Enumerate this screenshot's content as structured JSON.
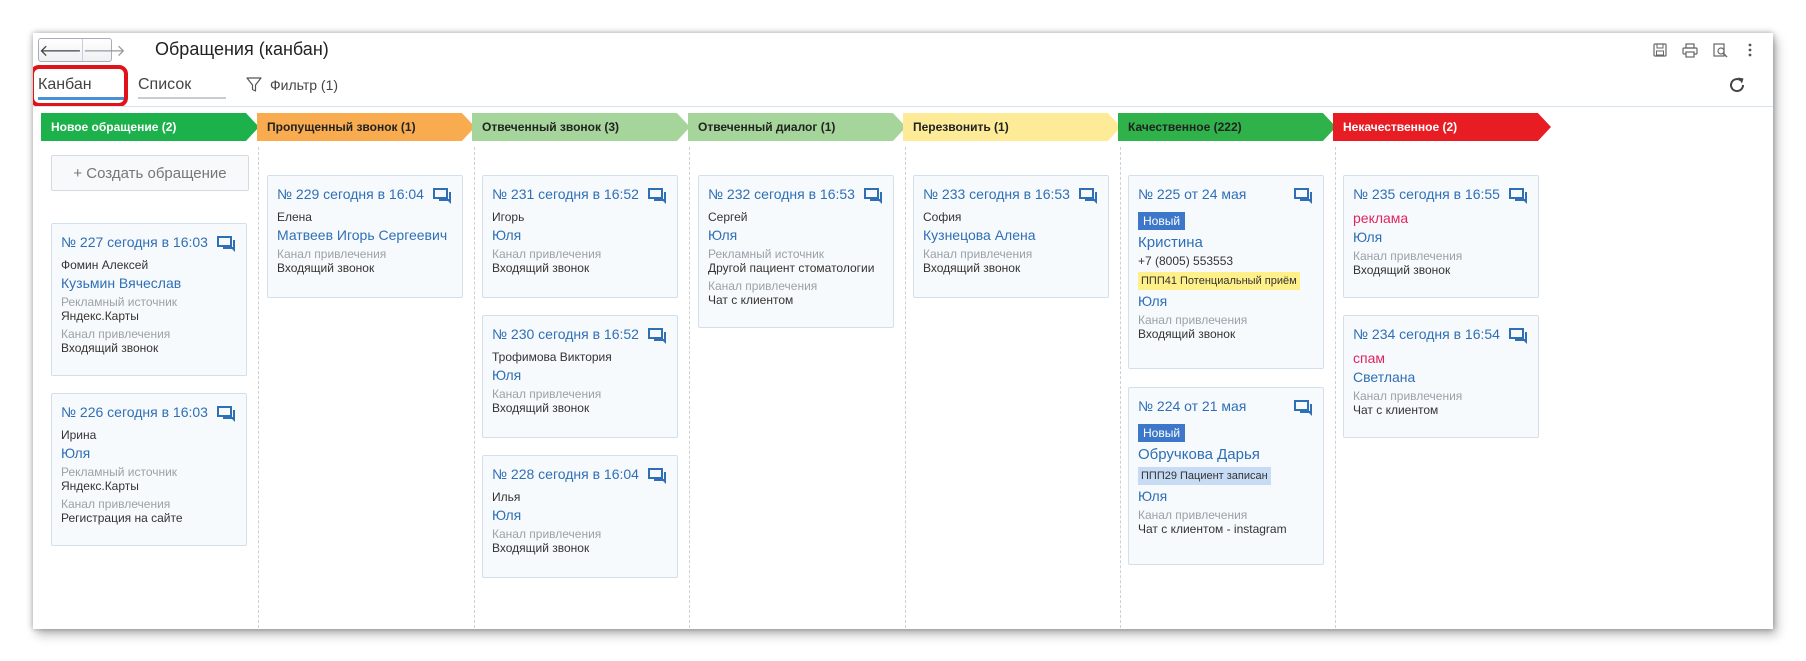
{
  "window": {
    "title": "Обращения (канбан)"
  },
  "nav": {
    "back": "🡐",
    "forward": "🡒"
  },
  "top_icons": [
    "save-icon",
    "print-icon",
    "preview-icon",
    "more-icon"
  ],
  "tabs": [
    {
      "label": "Канбан",
      "active": true
    },
    {
      "label": "Список",
      "active": false
    }
  ],
  "filter": {
    "label": "Фильтр (1)"
  },
  "columns": [
    {
      "title": "Новое обращение (2)",
      "color": "#1db14b",
      "create_label": "+ Создать обращение",
      "cards": [
        {
          "title": "№ 227 сегодня в 16:03",
          "client": "Фомин Алексей",
          "manager": "Кузьмин Вячеслав",
          "src_label": "Рекламный источник",
          "src_value": "Яндекс.Карты",
          "ch_label": "Канал привлечения",
          "ch_value": "Входящий звонок"
        },
        {
          "title": "№ 226 сегодня в 16:03",
          "client": "Ирина",
          "manager": "Юля",
          "src_label": "Рекламный источник",
          "src_value": "Яндекс.Карты",
          "ch_label": "Канал привлечения",
          "ch_value": "Регистрация на сайте"
        }
      ]
    },
    {
      "title": "Пропущенный звонок (1)",
      "color": "#f9ab4f",
      "cards": [
        {
          "title": "№ 229 сегодня в 16:04",
          "client": "Елена",
          "manager": "Матвеев Игорь Сергеевич",
          "ch_label": "Канал привлечения",
          "ch_value": "Входящий звонок"
        }
      ]
    },
    {
      "title": "Отвеченный звонок (3)",
      "color": "#a5d59a",
      "cards": [
        {
          "title": "№ 231 сегодня в 16:52",
          "client": "Игорь",
          "manager": "Юля",
          "ch_label": "Канал привлечения",
          "ch_value": "Входящий звонок"
        },
        {
          "title": "№ 230 сегодня в 16:52",
          "client": "Трофимова Виктория",
          "manager": "Юля",
          "ch_label": "Канал привлечения",
          "ch_value": "Входящий звонок"
        },
        {
          "title": "№ 228 сегодня в 16:04",
          "client": "Илья",
          "manager": "Юля",
          "ch_label": "Канал привлечения",
          "ch_value": "Входящий звонок"
        }
      ]
    },
    {
      "title": "Отвеченный диалог (1)",
      "color": "#a5d59a",
      "cards": [
        {
          "title": "№ 232 сегодня в 16:53",
          "client": "Сергей",
          "manager": "Юля",
          "src_label": "Рекламный источник",
          "src_value": "Другой пациент стоматологии",
          "ch_label": "Канал привлечения",
          "ch_value": "Чат с клиентом"
        }
      ]
    },
    {
      "title": "Перезвонить (1)",
      "color": "#fdeb98",
      "cards": [
        {
          "title": "№ 233 сегодня в 16:53",
          "client": "София",
          "manager": "Кузнецова Алена",
          "ch_label": "Канал привлечения",
          "ch_value": "Входящий звонок"
        }
      ]
    },
    {
      "title": "Качественное (222)",
      "color": "#2fb24a",
      "cards": [
        {
          "title": "№ 225 от 24 мая",
          "badge": "Новый",
          "name": "Кристина",
          "phone": "+7 (8005) 553553",
          "tag": "ППП41 Потенциальный приём",
          "manager": "Юля",
          "ch_label": "Канал привлечения",
          "ch_value": "Входящий звонок"
        },
        {
          "title": "№ 224 от 21 мая",
          "badge": "Новый",
          "name": "Обручкова Дарья",
          "tag": "ППП29 Пациент записан",
          "manager": "Юля",
          "ch_label": "Канал привлечения",
          "ch_value": "Чат с клиентом - instagram"
        }
      ]
    },
    {
      "title": "Некачественное (2)",
      "color": "#e81d24",
      "cards": [
        {
          "title": "№ 235 сегодня в 16:55",
          "reason": "реклама",
          "manager": "Юля",
          "ch_label": "Канал привлечения",
          "ch_value": "Входящий звонок"
        },
        {
          "title": "№ 234 сегодня в 16:54",
          "reason": "спам",
          "manager": "Светлана",
          "ch_label": "Канал привлечения",
          "ch_value": "Чат с клиентом"
        }
      ]
    }
  ]
}
